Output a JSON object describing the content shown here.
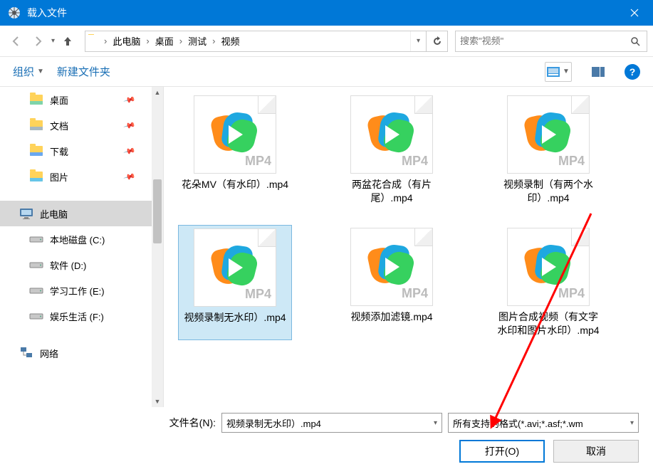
{
  "window": {
    "title": "载入文件"
  },
  "breadcrumb": {
    "items": [
      "此电脑",
      "桌面",
      "测试",
      "视频"
    ]
  },
  "search": {
    "placeholder": "搜索\"视频\""
  },
  "toolbar": {
    "organize": "组织",
    "newFolder": "新建文件夹"
  },
  "tree": {
    "items": [
      {
        "label": "桌面",
        "kind": "folder",
        "stripe": "#7fd4aa",
        "pinned": true,
        "level": 1
      },
      {
        "label": "文档",
        "kind": "folder",
        "stripe": "#a8b8c0",
        "pinned": true,
        "level": 1
      },
      {
        "label": "下载",
        "kind": "folder",
        "stripe": "#6aa8f0",
        "pinned": true,
        "level": 1
      },
      {
        "label": "图片",
        "kind": "folder",
        "stripe": "#66c5e8",
        "pinned": true,
        "level": 1
      },
      {
        "label": "此电脑",
        "kind": "pc",
        "pinned": false,
        "level": 0,
        "selected": true
      },
      {
        "label": "本地磁盘 (C:)",
        "kind": "drive",
        "pinned": false,
        "level": 1
      },
      {
        "label": "软件 (D:)",
        "kind": "drive",
        "pinned": false,
        "level": 1
      },
      {
        "label": "学习工作 (E:)",
        "kind": "drive",
        "pinned": false,
        "level": 1
      },
      {
        "label": "娱乐生活 (F:)",
        "kind": "drive",
        "pinned": false,
        "level": 1
      },
      {
        "label": "网络",
        "kind": "network",
        "pinned": false,
        "level": 0
      }
    ]
  },
  "files": [
    {
      "name": "花朵MV（有水印）.mp4",
      "fmt": "MP4",
      "selected": false
    },
    {
      "name": "两盆花合成（有片尾）.mp4",
      "fmt": "MP4",
      "selected": false
    },
    {
      "name": "视频录制（有两个水印）.mp4",
      "fmt": "MP4",
      "selected": false
    },
    {
      "name": "视频录制无水印）.mp4",
      "fmt": "MP4",
      "selected": true
    },
    {
      "name": "视频添加滤镜.mp4",
      "fmt": "MP4",
      "selected": false
    },
    {
      "name": "图片合成视频（有文字水印和图片水印）.mp4",
      "fmt": "MP4",
      "selected": false
    }
  ],
  "footer": {
    "fileNameLabel": "文件名(N):",
    "fileName": "视频录制无水印）.mp4",
    "filter": "所有支持的格式(*.avi;*.asf;*.wm",
    "open": "打开(O)",
    "cancel": "取消"
  }
}
